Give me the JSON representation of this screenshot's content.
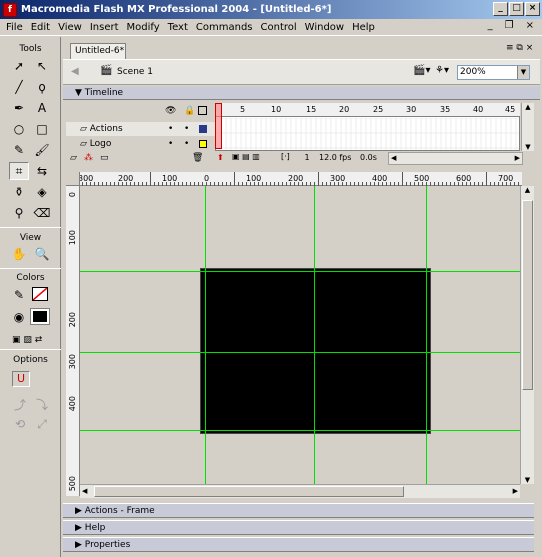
{
  "window": {
    "title": "Macromedia Flash MX Professional 2004 - [Untitled-6*]"
  },
  "menubar": {
    "items": [
      "File",
      "Edit",
      "View",
      "Insert",
      "Modify",
      "Text",
      "Commands",
      "Control",
      "Window",
      "Help"
    ]
  },
  "tools": {
    "header": "Tools",
    "view_label": "View",
    "colors_label": "Colors",
    "options_label": "Options"
  },
  "document": {
    "tab_label": "Untitled-6*",
    "scene_label": "Scene 1",
    "zoom_value": "200%"
  },
  "timeline": {
    "header": "Timeline",
    "frame_numbers": [
      "5",
      "10",
      "15",
      "20",
      "25",
      "30",
      "35",
      "40",
      "45"
    ],
    "layers": [
      {
        "name": "Actions",
        "frame_color": "#2a3a8a"
      },
      {
        "name": "Logo",
        "frame_color": "#ffff00"
      }
    ],
    "current_frame": "1",
    "frame_rate": "12.0 fps",
    "elapsed": "0.0s"
  },
  "rulers": {
    "horizontal_labels": [
      "300",
      "200",
      "100",
      "0",
      "100",
      "200",
      "300",
      "400",
      "500",
      "600",
      "700"
    ],
    "vertical_labels": [
      "0",
      "100",
      "200",
      "300",
      "400",
      "500"
    ]
  },
  "panels": [
    "Actions - Frame",
    "Help",
    "Properties"
  ],
  "colors": {
    "guide": "#00e000",
    "stage": "#000000"
  }
}
